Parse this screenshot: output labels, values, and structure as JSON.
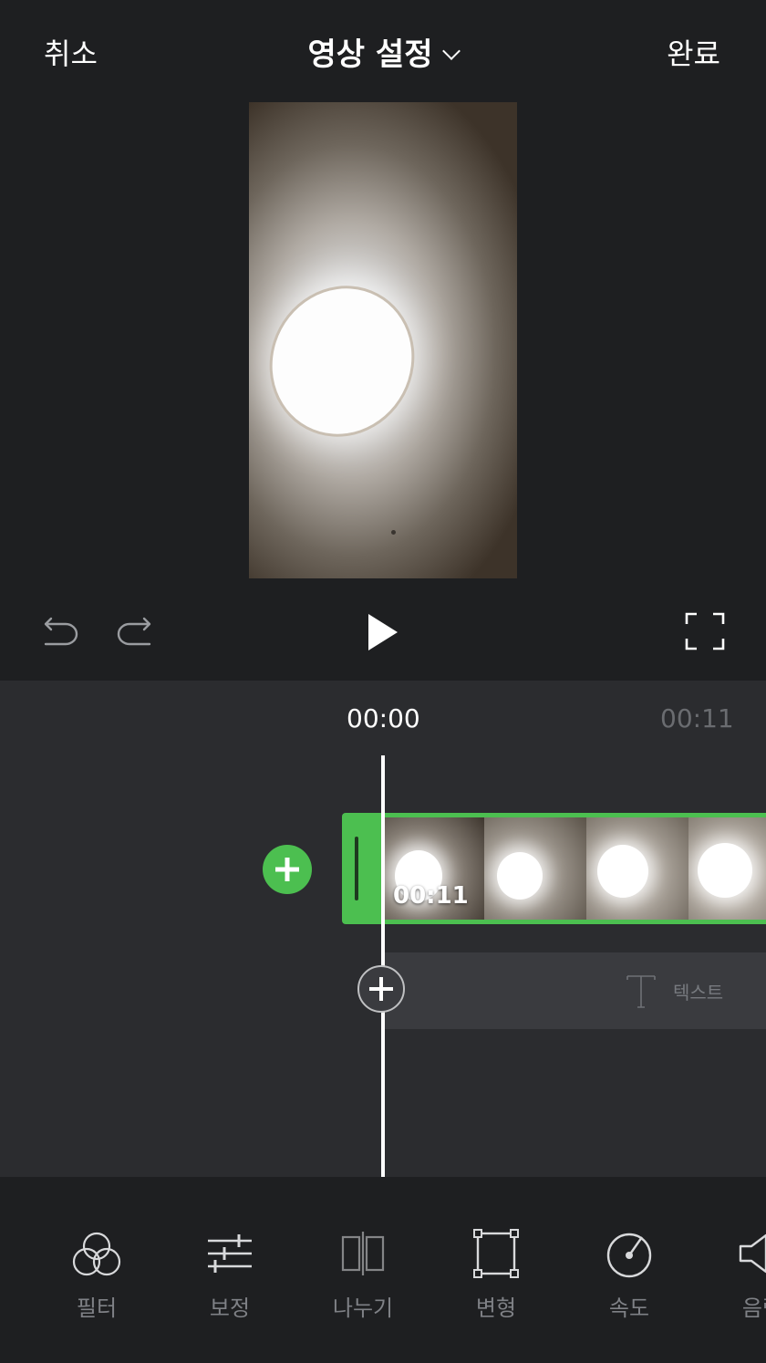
{
  "header": {
    "cancel_label": "취소",
    "title": "영상 설정",
    "done_label": "완료"
  },
  "preview": {
    "description_icon": "video-preview"
  },
  "controls": {
    "undo_icon": "undo-icon",
    "redo_icon": "redo-icon",
    "play_icon": "play-icon",
    "fullscreen_icon": "fullscreen-icon"
  },
  "timeline": {
    "current_time": "00:00",
    "end_time": "00:11",
    "clip_duration": "00:11",
    "text_track_label": "텍스트"
  },
  "toolbar": {
    "items": [
      {
        "label": "필터",
        "icon": "filter-icon"
      },
      {
        "label": "보정",
        "icon": "adjust-icon"
      },
      {
        "label": "나누기",
        "icon": "split-icon"
      },
      {
        "label": "변형",
        "icon": "transform-icon"
      },
      {
        "label": "속도",
        "icon": "speed-icon"
      },
      {
        "label": "음량",
        "icon": "volume-icon"
      }
    ]
  },
  "colors": {
    "background": "#1e1f21",
    "timeline_bg": "#2b2c2f",
    "accent_green": "#4cbf50",
    "muted_text": "#7f8186"
  }
}
